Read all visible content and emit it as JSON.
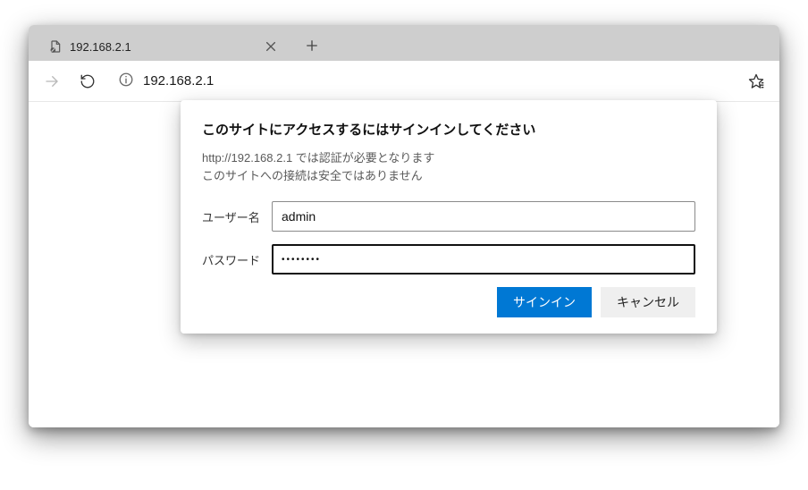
{
  "tab": {
    "title": "192.168.2.1"
  },
  "addressbar": {
    "url": "192.168.2.1"
  },
  "dialog": {
    "title": "このサイトにアクセスするにはサインインしてください",
    "line1": "http://192.168.2.1 では認証が必要となります",
    "line2": "このサイトへの接続は安全ではありません",
    "username_label": "ユーザー名",
    "username_value": "admin",
    "password_label": "パスワード",
    "password_value": "••••••••",
    "signin_label": "サインイン",
    "cancel_label": "キャンセル"
  }
}
